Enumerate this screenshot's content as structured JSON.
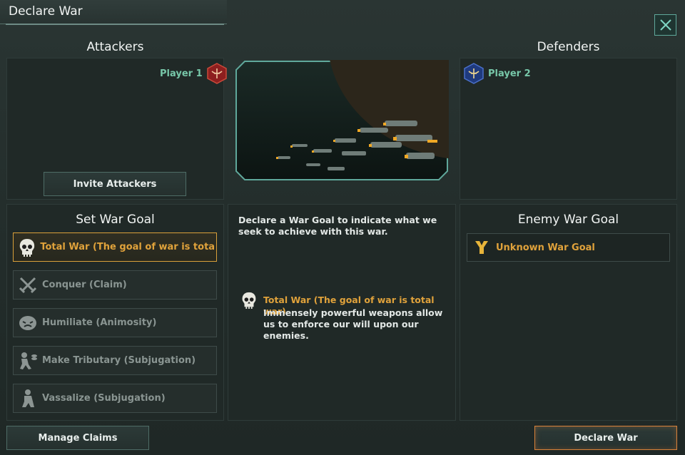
{
  "window": {
    "title": "Declare War"
  },
  "attackers": {
    "heading": "Attackers",
    "player": "Player 1",
    "invite_label": "Invite Attackers"
  },
  "defenders": {
    "heading": "Defenders",
    "player": "Player 2"
  },
  "war_goal": {
    "heading": "Set War Goal",
    "options": [
      {
        "label": "Total War (The goal of war is tota ...",
        "icon": "skull-icon",
        "selected": true
      },
      {
        "label": "Conquer (Claim)",
        "icon": "crossed-swords-icon",
        "selected": false
      },
      {
        "label": "Humiliate (Animosity)",
        "icon": "humiliate-icon",
        "selected": false
      },
      {
        "label": "Make Tributary (Subjugation)",
        "icon": "kneel-tribute-icon",
        "selected": false
      },
      {
        "label": "Vassalize (Subjugation)",
        "icon": "kneel-icon",
        "selected": false
      }
    ]
  },
  "description": {
    "intro": "Declare a War Goal to indicate what we seek to achieve with this war.",
    "goal_title": "Total War (The goal of war is total war)",
    "goal_text": "Immensely powerful weapons allow us to enforce our will upon our enemies."
  },
  "enemy_goal": {
    "heading": "Enemy War Goal",
    "label": "Unknown War Goal"
  },
  "footer": {
    "manage_claims": "Manage Claims",
    "declare_war": "Declare War"
  },
  "colors": {
    "accent": "#e0a23b",
    "player": "#77c7a9",
    "frame": "#5fa89b"
  }
}
